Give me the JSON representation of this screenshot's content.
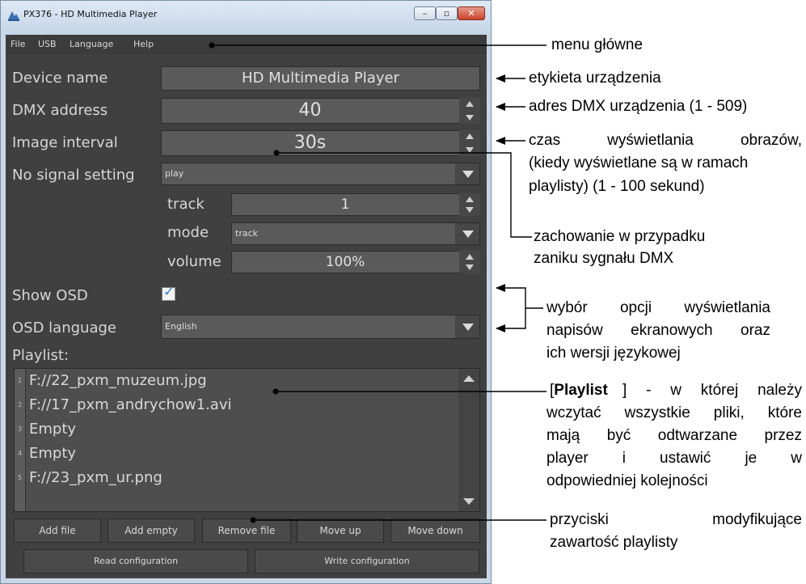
{
  "window": {
    "title": "PX376 - HD Multimedia Player",
    "app_icon": "mixer-icon",
    "buttons": {
      "minimize": "–",
      "maximize": "▫",
      "close": "✕"
    }
  },
  "menu": {
    "items": [
      "File",
      "USB",
      "Language",
      "Help"
    ]
  },
  "form": {
    "device_name_label": "Device name",
    "device_name_value": "HD Multimedia Player",
    "dmx_address_label": "DMX address",
    "dmx_address_value": "40",
    "image_interval_label": "Image interval",
    "image_interval_value": "30s",
    "no_signal_label": "No signal setting",
    "no_signal_value": "play",
    "track_label": "track",
    "track_value": "1",
    "mode_label": "mode",
    "mode_value": "track",
    "volume_label": "volume",
    "volume_value": "100%",
    "show_osd_label": "Show OSD",
    "show_osd_checked": true,
    "osd_language_label": "OSD language",
    "osd_language_value": "English",
    "playlist_label": "Playlist:"
  },
  "playlist": {
    "rows": [
      {
        "num": "1",
        "text": "F://22_pxm_muzeum.jpg"
      },
      {
        "num": "2",
        "text": "F://17_pxm_andrychow1.avi"
      },
      {
        "num": "3",
        "text": "Empty"
      },
      {
        "num": "4",
        "text": "Empty"
      },
      {
        "num": "5",
        "text": "F://23_pxm_ur.png"
      }
    ]
  },
  "buttons": {
    "add_file": "Add file",
    "add_empty": "Add empty",
    "remove_file": "Remove file",
    "move_up": "Move up",
    "move_down": "Move down",
    "read_config": "Read configuration",
    "write_config": "Write configuration"
  },
  "annotations": {
    "menu": "menu główne",
    "device_label": "etykieta urządzenia",
    "dmx": "adres DMX urządzenia (1 - 509)",
    "interval_line1": "czas wyświetlania obrazów,",
    "interval_line2": "(kiedy wyświetlane są w ramach",
    "interval_line3": "playlisty) (1 - 100 sekund)",
    "no_signal_line1": "zachowanie w przypadku",
    "no_signal_line2": "zaniku sygnału DMX",
    "osd_line1": "wybór opcji wyświetlania",
    "osd_line2": "napisów ekranowych oraz",
    "osd_line3": "ich wersji językowej",
    "playlist_bold": "Playlist",
    "playlist_line1_rest": "] - w której należy",
    "playlist_line2": "wczytać wszystkie pliki, które",
    "playlist_line3": "mają być odtwarzane przez",
    "playlist_line4": "player i ustawić je w",
    "playlist_line5": "odpowiedniej kolejności",
    "buttons_line1": "przyciski modyfikujące",
    "buttons_line2": "zawartość playlisty"
  }
}
